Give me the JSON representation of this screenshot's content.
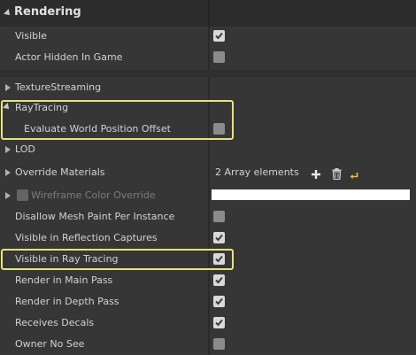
{
  "section": {
    "title": "Rendering"
  },
  "rows": {
    "visible": {
      "label": "Visible",
      "checked": true
    },
    "actor_hidden": {
      "label": "Actor Hidden In Game",
      "checked": false
    },
    "texture_streaming": {
      "label": "TextureStreaming"
    },
    "ray_tracing": {
      "label": "RayTracing"
    },
    "evaluate_wpo": {
      "label": "Evaluate World Position Offset",
      "checked": false
    },
    "lod": {
      "label": "LOD"
    },
    "override_materials": {
      "label": "Override Materials",
      "value": "2 Array elements"
    },
    "wireframe": {
      "label": "Wireframe Color Override",
      "color": "#ffffff"
    },
    "disallow_mesh_paint": {
      "label": "Disallow Mesh Paint Per Instance",
      "checked": false
    },
    "visible_reflection": {
      "label": "Visible in Reflection Captures",
      "checked": true
    },
    "visible_ray_tracing": {
      "label": "Visible in Ray Tracing",
      "checked": true
    },
    "render_main_pass": {
      "label": "Render in Main Pass",
      "checked": true
    },
    "render_depth_pass": {
      "label": "Render in Depth Pass",
      "checked": true
    },
    "receives_decals": {
      "label": "Receives Decals",
      "checked": true
    },
    "owner_no_see": {
      "label": "Owner No See",
      "checked": false
    }
  },
  "colors": {
    "highlight": "#e8e27a",
    "reset_arrow": "#e6c63a"
  },
  "icons": {
    "add": "plus-icon",
    "delete": "trash-icon",
    "reset": "reset-arrow-icon"
  }
}
